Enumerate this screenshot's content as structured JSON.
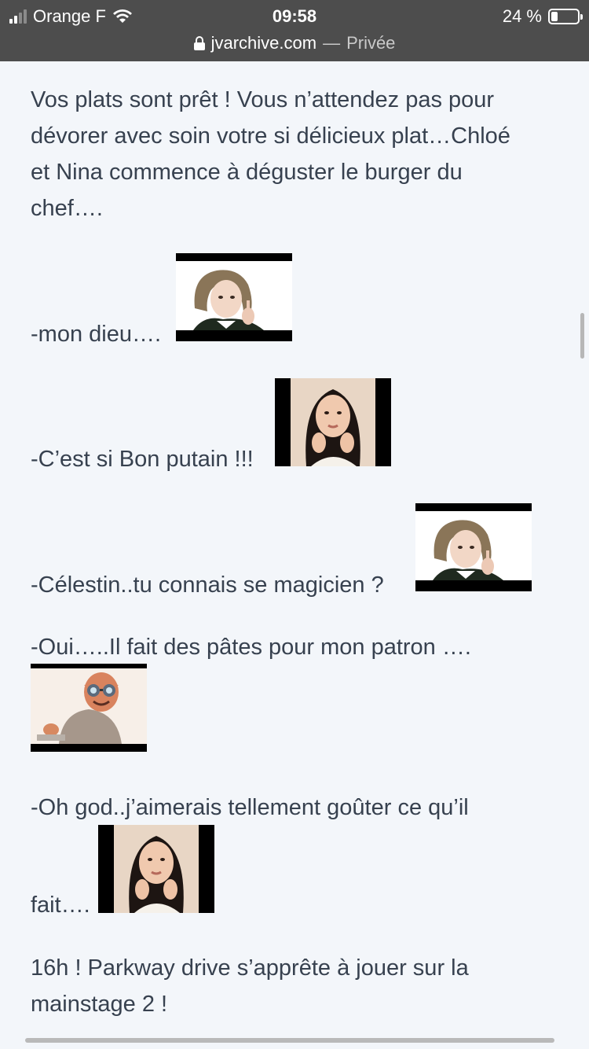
{
  "status_bar": {
    "carrier": "Orange F",
    "time": "09:58",
    "battery_label": "24 %",
    "battery_level": 0.24,
    "signal_bars": 2,
    "signal_total": 4
  },
  "address_bar": {
    "domain": "jvarchive.com",
    "separator": "—",
    "mode": "Privée"
  },
  "post": {
    "intro_lines": [
      "Vos plats sont prêt ! Vous n’attendez pas pour",
      "dévorer avec soin votre si délicieux plat…Chloé",
      "et Nina commence à déguster le burger du",
      "chef…."
    ],
    "line_mon_dieu": "-mon dieu….",
    "line_si_bon": "-C’est si Bon putain !!!",
    "line_celestin": "-Célestin..tu connais se magicien ?",
    "line_oui": "-Oui…..Il fait des pâtes pour mon patron ….",
    "line_oh_god": "-Oh god..j’aimerais tellement goûter ce qu’il",
    "line_fait": "fait….",
    "outro_lines": [
      "16h ! Parkway drive s’apprête à jouer sur la",
      "mainstage 2 !"
    ]
  },
  "stickers": {
    "sticker_1": "girl-bob-haircut-sticker",
    "sticker_2": "girl-braids-sticker",
    "sticker_3": "girl-bob-haircut-sticker",
    "sticker_4": "risitas-sunglasses-sticker",
    "sticker_5": "girl-braids-sticker"
  },
  "colors": {
    "status_bar_bg": "#4d4d4d",
    "page_bg": "#f3f6fa",
    "text": "#37414f"
  }
}
